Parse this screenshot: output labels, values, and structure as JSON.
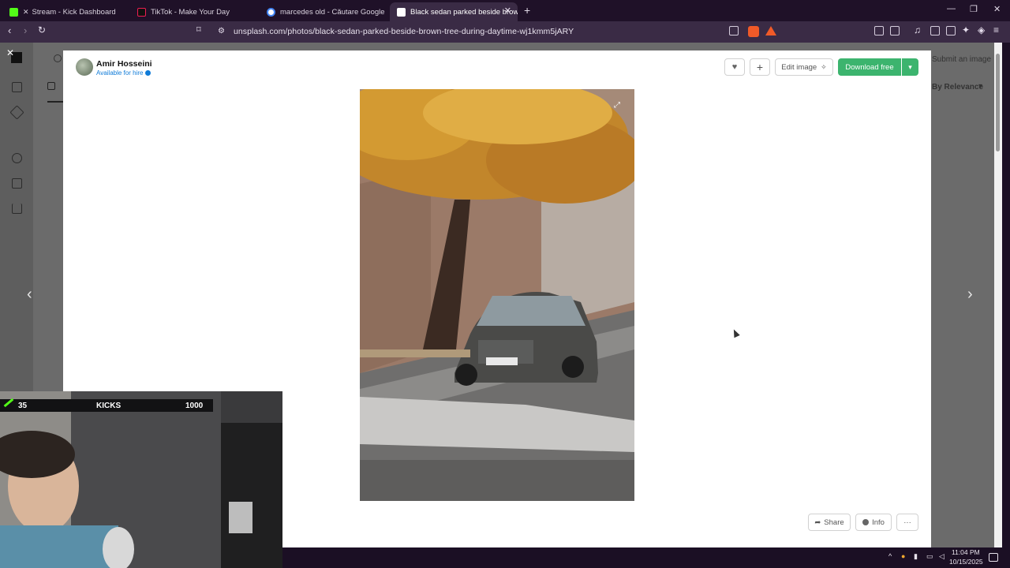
{
  "browser": {
    "tabs": [
      {
        "title": "Stream - Kick Dashboard",
        "favicon": "kick-icon",
        "active": false
      },
      {
        "title": "TikTok - Make Your Day",
        "favicon": "tiktok-icon",
        "active": false
      },
      {
        "title": "marcedes old - Căutare Google",
        "favicon": "google-icon",
        "active": false
      },
      {
        "title": "Black sedan parked beside brow",
        "favicon": "unsplash-icon",
        "active": true
      }
    ],
    "url": "unsplash.com/photos/black-sedan-parked-beside-brown-tree-during-daytime-wj1kmm5jARY"
  },
  "background_page": {
    "submit_label": "Submit an image",
    "sort_label": "By Relevance"
  },
  "modal": {
    "author_name": "Amir Hosseini",
    "author_status": "Available for hire",
    "edit_label": "Edit image",
    "download_label": "Download free",
    "share_label": "Share",
    "info_label": "Info",
    "more_label": "···"
  },
  "stream_overlay": {
    "left_value": "35",
    "center_label": "KICKS",
    "right_value": "1000"
  },
  "taskbar": {
    "time": "11:04 PM",
    "date": "10/15/2025"
  },
  "colors": {
    "accent_green": "#3cb46e",
    "link_blue": "#0f7bd8",
    "browser_chrome": "#3a2b45"
  }
}
